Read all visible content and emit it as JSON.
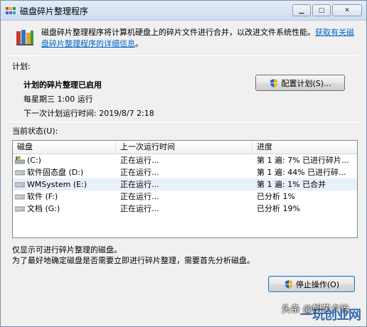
{
  "window": {
    "title": "磁盘碎片整理程序",
    "minimize_glyph": "▁",
    "maximize_glyph": "□",
    "close_glyph": "✕"
  },
  "intro": {
    "text": "磁盘碎片整理程序将计算机硬盘上的碎片文件进行合并，以改进文件系统性能。",
    "link": "获取有关磁盘碎片整理程序的详细信息",
    "end": "。"
  },
  "schedule": {
    "label": "计划:",
    "title": "计划的碎片整理已启用",
    "frequency": "每星期三 1:00 运行",
    "next_run": "下一次计划运行时间: 2019/8/7 2:18",
    "configure_button": "配置计划(S)..."
  },
  "status": {
    "label": "当前状态(U):",
    "columns": [
      "磁盘",
      "上一次运行时间",
      "进度"
    ],
    "rows": [
      {
        "disk": "(C:)",
        "last_run": "正在运行...",
        "progress": "第 1 遍: 7% 已进行碎片...",
        "icon": "system-drive-icon",
        "selected": false
      },
      {
        "disk": "软件固态盘 (D:)",
        "last_run": "正在运行...",
        "progress": "第 1 遍: 44% 已进行碎...",
        "icon": "drive-icon",
        "selected": false
      },
      {
        "disk": "WMSystem (E:)",
        "last_run": "正在运行...",
        "progress": "第 1 遍: 1% 已合并",
        "icon": "drive-icon",
        "selected": true
      },
      {
        "disk": "软件 (F:)",
        "last_run": "正在运行...",
        "progress": "已分析 1%",
        "icon": "drive-icon",
        "selected": false
      },
      {
        "disk": "文档 (G:)",
        "last_run": "正在运行...",
        "progress": "已分析 19%",
        "icon": "drive-icon",
        "selected": false
      }
    ]
  },
  "info": {
    "line1": "仅显示可进行碎片整理的磁盘。",
    "line2": "为了最好地确定磁盘是否需要立即进行碎片整理，需要首先分析磁盘。"
  },
  "actions": {
    "stop_button": "停止操作(O)"
  },
  "watermark": {
    "text": "头条 @朝花夕拾",
    "brand": "一玩创业网"
  },
  "colors": {
    "link": "#0066cc",
    "accent": "#3c7fb1"
  }
}
